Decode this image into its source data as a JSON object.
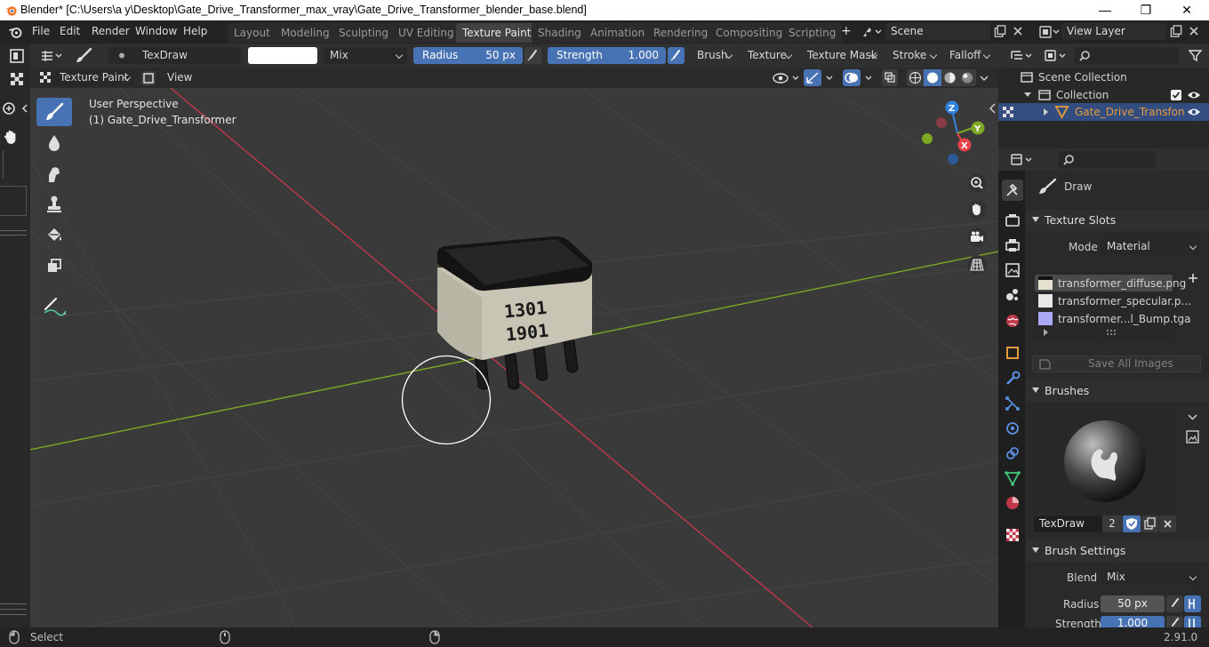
{
  "window": {
    "title": "Blender* [C:\\Users\\a y\\Desktop\\Gate_Drive_Transformer_max_vray\\Gate_Drive_Transformer_blender_base.blend]",
    "minimize": "—",
    "maximize": "❐",
    "close": "✕"
  },
  "menu": [
    "File",
    "Edit",
    "Render",
    "Window",
    "Help"
  ],
  "workspaces": [
    "Layout",
    "Modeling",
    "Sculpting",
    "UV Editing",
    "Texture Paint",
    "Shading",
    "Animation",
    "Rendering",
    "Compositing",
    "Scripting"
  ],
  "active_workspace": "Texture Paint",
  "add_workspace": "+",
  "scene": "Scene",
  "view_layer": "View Layer",
  "tool_header": {
    "brush_name": "TexDraw",
    "blend_mode": "Mix",
    "radius_label": "Radius",
    "radius_value": "50 px",
    "strength_label": "Strength",
    "strength_value": "1.000",
    "strength_fraction": 1.0,
    "menus": [
      "Brush",
      "Texture",
      "Texture Mask",
      "Stroke",
      "Falloff"
    ]
  },
  "viewport_header": {
    "mode": "Texture Paint",
    "view_menu": "View"
  },
  "viewport": {
    "perspective": "User Perspective",
    "object": "(1) Gate_Drive_Transformer",
    "marking_top": "1301",
    "marking_bottom": "1901",
    "gizmo": {
      "z": "Z",
      "y": "Y",
      "x": "X"
    }
  },
  "outliner": {
    "root": "Scene Collection",
    "collection": "Collection",
    "object": "Gate_Drive_Transfon"
  },
  "properties": {
    "active_tool": "Draw",
    "texture_slots": {
      "title": "Texture Slots",
      "mode_label": "Mode",
      "mode_value": "Material",
      "slots": [
        "transformer_diffuse.png",
        "transformer_specular.p...",
        "transformer...l_Bump.tga"
      ],
      "save_all": "Save All Images"
    },
    "brushes": {
      "title": "Brushes",
      "brush_name": "TexDraw",
      "users": "2"
    },
    "brush_settings": {
      "title": "Brush Settings",
      "blend_label": "Blend",
      "blend_value": "Mix",
      "radius_label": "Radius",
      "radius_value": "50 px",
      "strength_label": "Strength",
      "strength_value": "1.000"
    }
  },
  "status": {
    "select": "Select",
    "version": "2.91.0"
  },
  "colors": {
    "accent": "#4772b3",
    "active_object": "#e59b3a",
    "x_axis": "#e8434b",
    "y_axis": "#7ea823",
    "z_axis": "#2f82e0",
    "viewport_bg": "#3a3a3a"
  }
}
